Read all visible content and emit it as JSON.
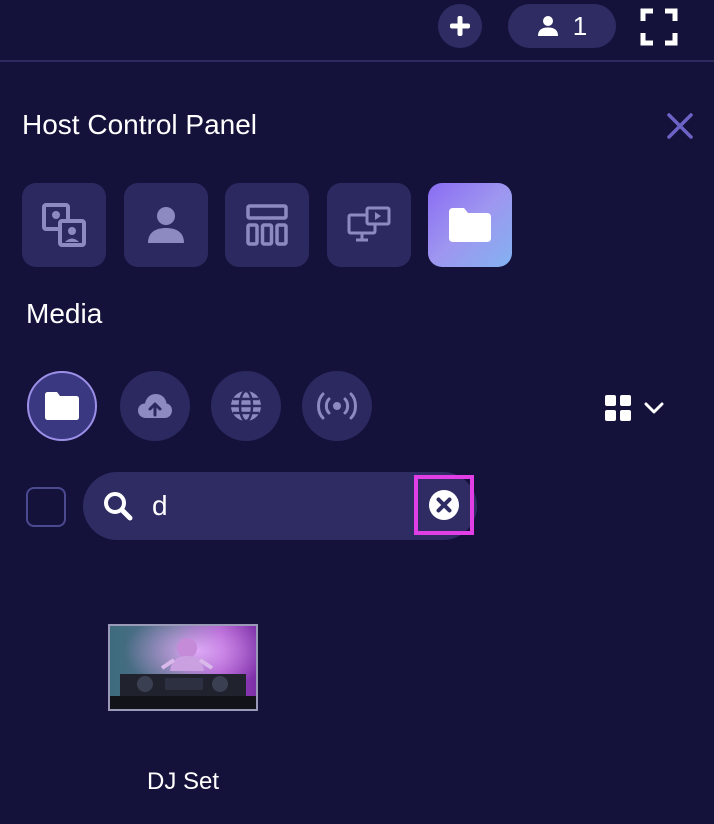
{
  "topbar": {
    "add_icon": "plus-icon",
    "participants_icon": "person-icon",
    "participants_count": "1",
    "fullscreen_icon": "fullscreen-icon"
  },
  "panel": {
    "title": "Host Control Panel",
    "close_icon": "close-icon",
    "categories": [
      {
        "icon": "layout-swap-icon",
        "active": false
      },
      {
        "icon": "person-icon",
        "active": false
      },
      {
        "icon": "grid-layout-icon",
        "active": false
      },
      {
        "icon": "screen-share-icon",
        "active": false
      },
      {
        "icon": "folder-icon",
        "active": true
      }
    ]
  },
  "media": {
    "section_title": "Media",
    "sources": [
      {
        "icon": "folder-icon",
        "active": true
      },
      {
        "icon": "cloud-upload-icon",
        "active": false
      },
      {
        "icon": "globe-icon",
        "active": false
      },
      {
        "icon": "broadcast-icon",
        "active": false
      }
    ],
    "view_icon": "grid-view-icon",
    "view_dropdown_icon": "chevron-down-icon",
    "search": {
      "value": "d",
      "placeholder": ""
    },
    "items": [
      {
        "label": "DJ Set"
      }
    ]
  },
  "colors": {
    "background": "#14123a",
    "surface": "#2b2960",
    "accent": "#8a6cf3",
    "highlight": "#e13ee6"
  }
}
